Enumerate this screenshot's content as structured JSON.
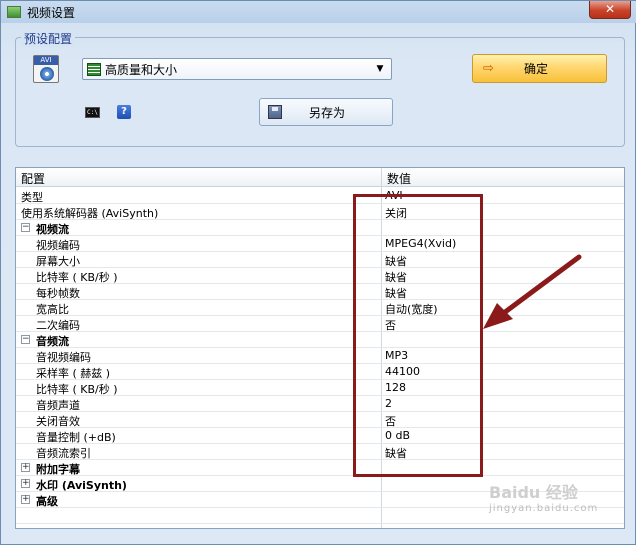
{
  "window": {
    "title": "视频设置",
    "close_label": "✕"
  },
  "preset": {
    "legend": "预设配置",
    "avi_icon_label": "AVI",
    "selected": "高质量和大小",
    "cmd_icon_label": "C:\\",
    "help_icon_label": "?",
    "save_as_label": "另存为",
    "ok_label": "确定"
  },
  "grid": {
    "columns": [
      "配置",
      "数值"
    ],
    "rows": [
      {
        "key": "类型",
        "value": "AVI",
        "level": 0,
        "group": false
      },
      {
        "key": "使用系统解码器 (AviSynth)",
        "value": "关闭",
        "level": 0,
        "group": false
      },
      {
        "key": "视频流",
        "value": "",
        "level": 0,
        "group": true,
        "expander": "−"
      },
      {
        "key": "视频编码",
        "value": "MPEG4(Xvid)",
        "level": 1,
        "group": false
      },
      {
        "key": "屏幕大小",
        "value": "缺省",
        "level": 1,
        "group": false
      },
      {
        "key": "比特率 ( KB/秒 )",
        "value": "缺省",
        "level": 1,
        "group": false
      },
      {
        "key": "每秒帧数",
        "value": "缺省",
        "level": 1,
        "group": false
      },
      {
        "key": "宽高比",
        "value": "自动(宽度)",
        "level": 1,
        "group": false
      },
      {
        "key": "二次编码",
        "value": "否",
        "level": 1,
        "group": false
      },
      {
        "key": "音频流",
        "value": "",
        "level": 0,
        "group": true,
        "expander": "−"
      },
      {
        "key": "音视频编码",
        "value": "MP3",
        "level": 1,
        "group": false
      },
      {
        "key": "采样率 ( 赫兹 )",
        "value": "44100",
        "level": 1,
        "group": false
      },
      {
        "key": "比特率 ( KB/秒 )",
        "value": "128",
        "level": 1,
        "group": false
      },
      {
        "key": "音频声道",
        "value": "2",
        "level": 1,
        "group": false
      },
      {
        "key": "关闭音效",
        "value": "否",
        "level": 1,
        "group": false
      },
      {
        "key": "音量控制 (+dB)",
        "value": "0 dB",
        "level": 1,
        "group": false
      },
      {
        "key": "音频流索引",
        "value": "缺省",
        "level": 1,
        "group": false
      },
      {
        "key": "附加字幕",
        "value": "",
        "level": 0,
        "group": true,
        "expander": "+"
      },
      {
        "key": "水印 (AviSynth)",
        "value": "",
        "level": 0,
        "group": true,
        "expander": "+"
      },
      {
        "key": "高级",
        "value": "",
        "level": 0,
        "group": true,
        "expander": "+"
      }
    ]
  },
  "annotation": {
    "box_color": "#8b1a1a"
  },
  "watermark": {
    "main": "Baidu 经验",
    "sub": "jingyan.baidu.com"
  }
}
